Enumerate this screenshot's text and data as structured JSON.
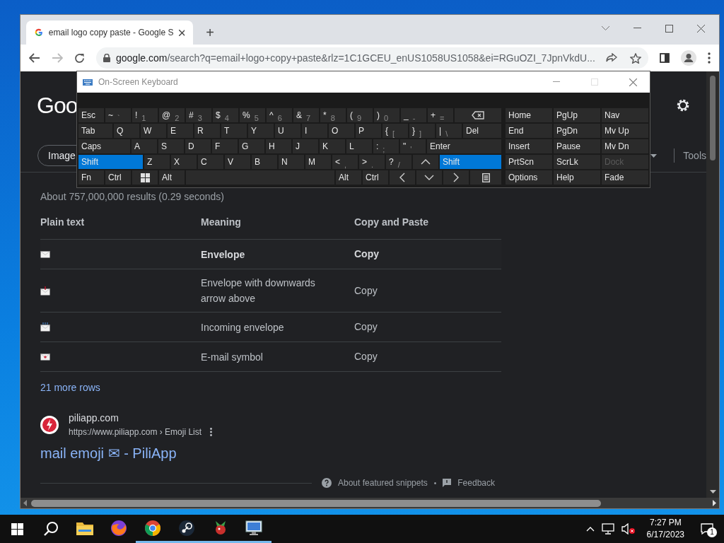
{
  "browser": {
    "tab": {
      "title": "email logo copy paste - Google S",
      "selected": true
    },
    "new_tab": "+",
    "url": {
      "host": "google.com",
      "path": "/search?q=email+logo+copy+paste&rlz=1C1GCEU_enUS1058US1058&ei=RGuOZI_7JpnVkdU..."
    }
  },
  "osk": {
    "title": "On-Screen Keyboard",
    "rows": [
      [
        {
          "label": "Esc",
          "kind": "key",
          "pressed": false
        },
        {
          "label": "~",
          "sub": "`",
          "kind": "key",
          "pressed": false
        },
        {
          "label": "!",
          "sub": "1",
          "kind": "key",
          "pressed": false
        },
        {
          "label": "@",
          "sub": "2",
          "kind": "key",
          "pressed": false
        },
        {
          "label": "#",
          "sub": "3",
          "kind": "key",
          "pressed": false
        },
        {
          "label": "$",
          "sub": "4",
          "kind": "key",
          "pressed": false
        },
        {
          "label": "%",
          "sub": "5",
          "kind": "key",
          "pressed": false
        },
        {
          "label": "^",
          "sub": "6",
          "kind": "key",
          "pressed": false
        },
        {
          "label": "&",
          "sub": "7",
          "kind": "key",
          "pressed": false
        },
        {
          "label": "*",
          "sub": "8",
          "kind": "key",
          "pressed": false
        },
        {
          "label": "(",
          "sub": "9",
          "kind": "key",
          "pressed": false
        },
        {
          "label": ")",
          "sub": "0",
          "kind": "key",
          "pressed": false
        },
        {
          "label": "_",
          "sub": "-",
          "kind": "key",
          "pressed": false
        },
        {
          "label": "+",
          "sub": "=",
          "kind": "key",
          "pressed": false
        },
        {
          "kind": "backspace",
          "pressed": false
        }
      ],
      [
        {
          "label": "Tab",
          "kind": "tab",
          "pressed": false
        },
        {
          "label": "Q",
          "kind": "key",
          "pressed": false
        },
        {
          "label": "W",
          "kind": "key",
          "pressed": false
        },
        {
          "label": "E",
          "kind": "key",
          "pressed": false
        },
        {
          "label": "R",
          "kind": "key",
          "pressed": false
        },
        {
          "label": "T",
          "kind": "key",
          "pressed": false
        },
        {
          "label": "Y",
          "kind": "key",
          "pressed": false
        },
        {
          "label": "U",
          "kind": "key",
          "pressed": false
        },
        {
          "label": "I",
          "kind": "key",
          "pressed": false
        },
        {
          "label": "O",
          "kind": "key",
          "pressed": false
        },
        {
          "label": "P",
          "kind": "key",
          "pressed": false
        },
        {
          "label": "{",
          "sub": "[",
          "kind": "key",
          "pressed": false
        },
        {
          "label": "}",
          "sub": "]",
          "kind": "key",
          "pressed": false
        },
        {
          "label": "|",
          "sub": "\\",
          "kind": "key",
          "pressed": false
        },
        {
          "label": "Del",
          "kind": "key",
          "pressed": false
        }
      ],
      [
        {
          "label": "Caps",
          "kind": "caps",
          "pressed": false
        },
        {
          "label": "A",
          "kind": "key",
          "pressed": false
        },
        {
          "label": "S",
          "kind": "key",
          "pressed": false
        },
        {
          "label": "D",
          "kind": "key",
          "pressed": false
        },
        {
          "label": "F",
          "kind": "key",
          "pressed": false
        },
        {
          "label": "G",
          "kind": "key",
          "pressed": false
        },
        {
          "label": "H",
          "kind": "key",
          "pressed": false
        },
        {
          "label": "J",
          "kind": "key",
          "pressed": false
        },
        {
          "label": "K",
          "kind": "key",
          "pressed": false
        },
        {
          "label": "L",
          "kind": "key",
          "pressed": false
        },
        {
          "label": ":",
          "sub": ";",
          "kind": "key",
          "pressed": false
        },
        {
          "label": "\"",
          "sub": "'",
          "kind": "key",
          "pressed": false
        },
        {
          "label": "Enter",
          "kind": "key",
          "pressed": false
        }
      ],
      [
        {
          "label": "Shift",
          "kind": "shift",
          "pressed": true
        },
        {
          "label": "Z",
          "kind": "key",
          "pressed": false
        },
        {
          "label": "X",
          "kind": "key",
          "pressed": false
        },
        {
          "label": "C",
          "kind": "key",
          "pressed": false
        },
        {
          "label": "V",
          "kind": "key",
          "pressed": false
        },
        {
          "label": "B",
          "kind": "key",
          "pressed": false
        },
        {
          "label": "N",
          "kind": "key",
          "pressed": false
        },
        {
          "label": "M",
          "kind": "key",
          "pressed": false
        },
        {
          "label": "<",
          "sub": ",",
          "kind": "key",
          "pressed": false
        },
        {
          "label": ">",
          "sub": ".",
          "kind": "key",
          "pressed": false
        },
        {
          "label": "?",
          "sub": "/",
          "kind": "key",
          "pressed": false
        },
        {
          "kind": "up",
          "pressed": false
        },
        {
          "label": "Shift",
          "kind": "key",
          "pressed": true
        }
      ],
      [
        {
          "label": "Fn",
          "kind": "key",
          "pressed": false
        },
        {
          "label": "Ctrl",
          "kind": "key",
          "pressed": false
        },
        {
          "kind": "windows",
          "pressed": false
        },
        {
          "label": "Alt",
          "kind": "key",
          "pressed": false
        },
        {
          "kind": "space",
          "pressed": false
        },
        {
          "label": "Alt",
          "kind": "key",
          "pressed": false
        },
        {
          "label": "Ctrl",
          "kind": "key",
          "pressed": false
        },
        {
          "kind": "left",
          "pressed": false
        },
        {
          "kind": "down",
          "pressed": false
        },
        {
          "kind": "right",
          "pressed": false
        },
        {
          "kind": "menu",
          "pressed": false
        }
      ]
    ],
    "nav": [
      [
        {
          "label": "Home",
          "disabled": false
        },
        {
          "label": "PgUp",
          "disabled": false
        },
        {
          "label": "Nav",
          "disabled": false
        }
      ],
      [
        {
          "label": "End",
          "disabled": false
        },
        {
          "label": "PgDn",
          "disabled": false
        },
        {
          "label": "Mv Up",
          "disabled": false
        }
      ],
      [
        {
          "label": "Insert",
          "disabled": false
        },
        {
          "label": "Pause",
          "disabled": false
        },
        {
          "label": "Mv Dn",
          "disabled": false
        }
      ],
      [
        {
          "label": "PrtScn",
          "disabled": false
        },
        {
          "label": "ScrLk",
          "disabled": false
        },
        {
          "label": "Dock",
          "disabled": true
        }
      ],
      [
        {
          "label": "Options",
          "disabled": false
        },
        {
          "label": "Help",
          "disabled": false
        },
        {
          "label": "Fade",
          "disabled": false
        }
      ]
    ]
  },
  "google": {
    "logo": "Goo",
    "search_tab": "Image",
    "tools": "Tools",
    "result_count": "About 757,000,000 results (0.29 seconds)",
    "table": {
      "columns": [
        "Plain text",
        "Meaning",
        "Copy and Paste"
      ],
      "rows": [
        {
          "kind": "envelope",
          "meaning": "Envelope",
          "action": "Copy",
          "highlighted": true
        },
        {
          "kind": "arrow",
          "meaning": "Envelope with downwards arrow above",
          "action": "Copy",
          "highlighted": false
        },
        {
          "kind": "incoming",
          "meaning": "Incoming envelope",
          "action": "Copy",
          "highlighted": false
        },
        {
          "kind": "email",
          "meaning": "E-mail symbol",
          "action": "Copy",
          "highlighted": false
        }
      ]
    },
    "more_rows": "21 more rows",
    "result": {
      "site": "piliapp.com",
      "url": "https://www.piliapp.com › Emoji List",
      "title": "mail emoji ✉ - PiliApp"
    },
    "footer": {
      "about": "About featured snippets",
      "separator": "•",
      "feedback": "Feedback"
    }
  },
  "taskbar": {
    "apps": [
      {
        "kind": "folder",
        "running": false
      },
      {
        "kind": "firefox",
        "running": false
      },
      {
        "kind": "chrome",
        "running": true
      },
      {
        "kind": "steam",
        "running": true
      },
      {
        "kind": "plant",
        "running": true
      },
      {
        "kind": "monitor",
        "running": true
      }
    ],
    "time": "7:27 PM",
    "date": "6/17/2023",
    "notifications": "1"
  }
}
